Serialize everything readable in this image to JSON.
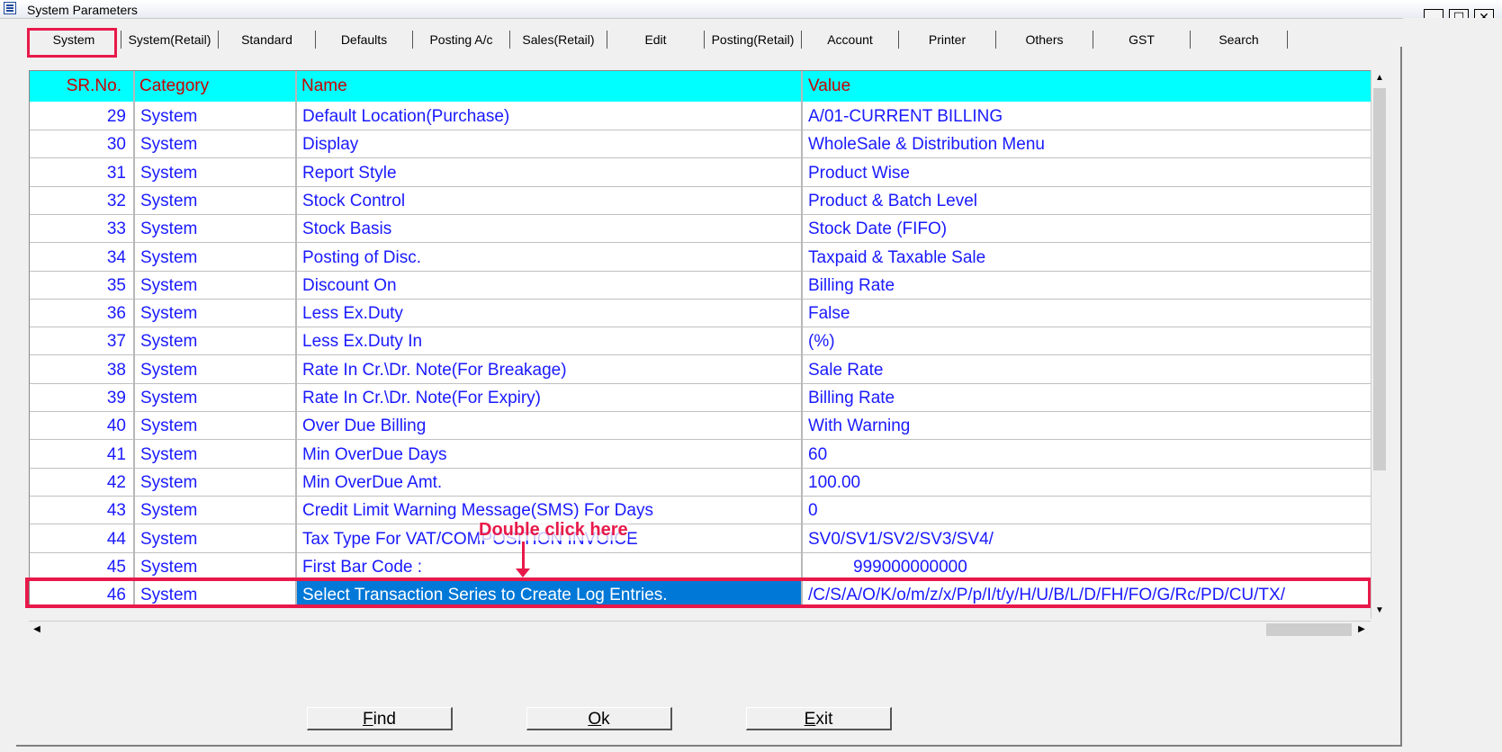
{
  "window": {
    "title": "System Parameters"
  },
  "tabs": [
    {
      "label": "System",
      "active": true
    },
    {
      "label": "System(Retail)"
    },
    {
      "label": "Standard"
    },
    {
      "label": "Defaults"
    },
    {
      "label": "Posting A/c"
    },
    {
      "label": "Sales(Retail)"
    },
    {
      "label": "Edit"
    },
    {
      "label": "Posting(Retail)"
    },
    {
      "label": "Account"
    },
    {
      "label": "Printer"
    },
    {
      "label": "Others"
    },
    {
      "label": "GST"
    },
    {
      "label": "Search"
    }
  ],
  "grid": {
    "headers": {
      "sr": "SR.No.",
      "category": "Category",
      "name": "Name",
      "value": "Value"
    },
    "rows": [
      {
        "sr": "29",
        "category": "System",
        "name": "Default Location(Purchase)",
        "value": "A/01-CURRENT BILLING"
      },
      {
        "sr": "30",
        "category": "System",
        "name": "Display",
        "value": "WholeSale & Distribution Menu"
      },
      {
        "sr": "31",
        "category": "System",
        "name": "Report Style",
        "value": "Product Wise"
      },
      {
        "sr": "32",
        "category": "System",
        "name": "Stock Control",
        "value": "Product & Batch Level"
      },
      {
        "sr": "33",
        "category": "System",
        "name": "Stock Basis",
        "value": "Stock Date (FIFO)"
      },
      {
        "sr": "34",
        "category": "System",
        "name": "Posting of Disc.",
        "value": "Taxpaid & Taxable Sale"
      },
      {
        "sr": "35",
        "category": "System",
        "name": "Discount On",
        "value": "Billing Rate"
      },
      {
        "sr": "36",
        "category": "System",
        "name": "Less Ex.Duty",
        "value": "False"
      },
      {
        "sr": "37",
        "category": "System",
        "name": "Less Ex.Duty In",
        "value": "(%)"
      },
      {
        "sr": "38",
        "category": "System",
        "name": "Rate In Cr.\\Dr. Note(For Breakage)",
        "value": "Sale Rate"
      },
      {
        "sr": "39",
        "category": "System",
        "name": "Rate In Cr.\\Dr. Note(For Expiry)",
        "value": "Billing Rate"
      },
      {
        "sr": "40",
        "category": "System",
        "name": "Over Due Billing",
        "value": "With Warning"
      },
      {
        "sr": "41",
        "category": "System",
        "name": "Min OverDue Days",
        "value": "60"
      },
      {
        "sr": "42",
        "category": "System",
        "name": "Min OverDue Amt.",
        "value": "100.00"
      },
      {
        "sr": "43",
        "category": "System",
        "name": "Credit Limit Warning Message(SMS) For Days",
        "value": "0"
      },
      {
        "sr": "44",
        "category": "System",
        "name": "Tax Type For VAT/COMPOSITION INVOICE",
        "value": "SV0/SV1/SV2/SV3/SV4/"
      },
      {
        "sr": "45",
        "category": "System",
        "name": "First Bar Code :",
        "value": "999000000000"
      },
      {
        "sr": "46",
        "category": "System",
        "name": "Select Transaction Series to Create Log Entries.",
        "value": "/C/S/A/O/K/o/m/z/x/P/p/I/t/y/H/U/B/L/D/FH/FO/G/Rc/PD/CU/TX/",
        "selected": true
      }
    ]
  },
  "annotation": {
    "text": "Double click here"
  },
  "buttons": {
    "find": {
      "hotkey": "F",
      "rest": "ind"
    },
    "ok": {
      "hotkey": "O",
      "rest": "k"
    },
    "exit": {
      "hotkey": "E",
      "rest": "xit"
    }
  },
  "colors": {
    "header_bg": "#00ffff",
    "header_text": "#cc0000",
    "cell_text": "#1a1aff",
    "selection": "#0078d7",
    "highlight": "#e8194a"
  }
}
